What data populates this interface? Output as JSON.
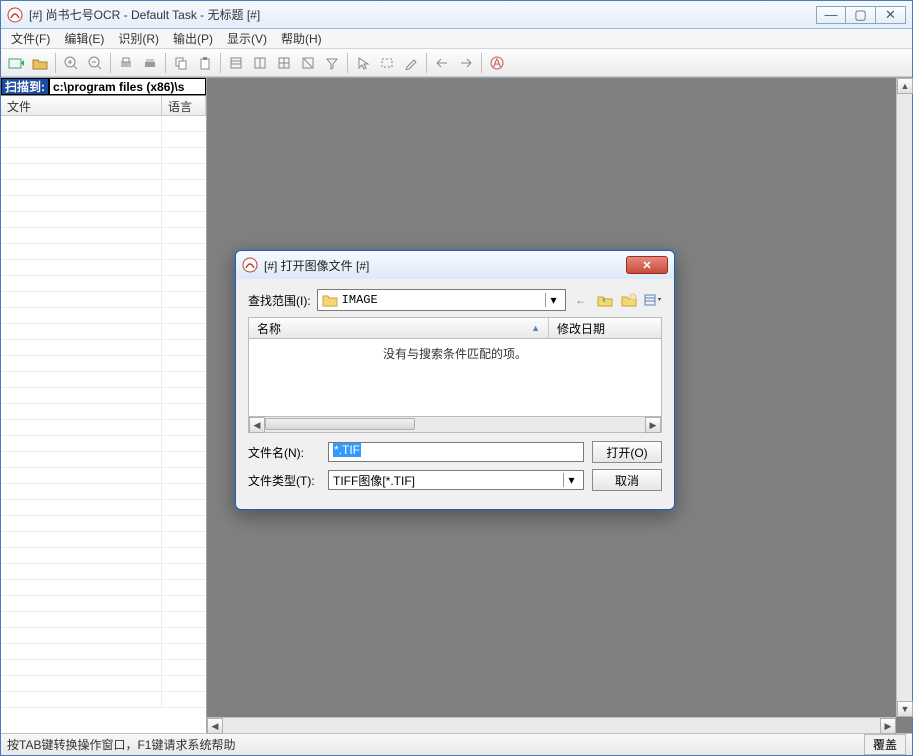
{
  "window": {
    "title": "[#] 尚书七号OCR - Default Task - 无标题 [#]"
  },
  "menu": {
    "file": "文件(F)",
    "edit": "编辑(E)",
    "recognize": "识别(R)",
    "output": "输出(P)",
    "display": "显示(V)",
    "help": "帮助(H)"
  },
  "left_panel": {
    "scan_label": "扫描到:",
    "scan_path": "c:\\program files (x86)\\s",
    "col_file": "文件",
    "col_lang": "语言"
  },
  "statusbar": {
    "text": "按TAB键转换操作窗口，F1键请求系统帮助",
    "mode": "覆盖"
  },
  "dialog": {
    "title": "[#] 打开图像文件 [#]",
    "look_in_label": "查找范围(I):",
    "folder": "IMAGE",
    "col_name": "名称",
    "col_date": "修改日期",
    "empty_msg": "没有与搜索条件匹配的项。",
    "filename_label": "文件名(N):",
    "filename_value": "*.TIF",
    "filetype_label": "文件类型(T):",
    "filetype_value": "TIFF图像[*.TIF]",
    "open_btn": "打开(O)",
    "cancel_btn": "取消"
  }
}
